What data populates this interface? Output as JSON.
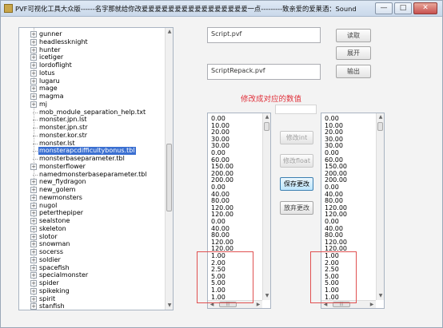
{
  "window": {
    "title": "PVF可视化工具大众版------名字那就给你改爰爰爰爰爰爰爰爰爰爰爰爰爰爰爰爰一点---------致亲爱的爱莱酒：Sound",
    "minimize_label": "—",
    "maximize_label": "□",
    "close_label": "✕"
  },
  "tree": {
    "items": [
      {
        "label": "gunner",
        "expandable": true
      },
      {
        "label": "headlessknight",
        "expandable": true
      },
      {
        "label": "hunter",
        "expandable": true
      },
      {
        "label": "icetiger",
        "expandable": true
      },
      {
        "label": "lordoflight",
        "expandable": true
      },
      {
        "label": "lotus",
        "expandable": true
      },
      {
        "label": "lugaru",
        "expandable": true
      },
      {
        "label": "mage",
        "expandable": true
      },
      {
        "label": "magma",
        "expandable": true
      },
      {
        "label": "mj",
        "expandable": true
      },
      {
        "label": "mob_module_separation_help.txt",
        "expandable": false
      },
      {
        "label": "monster.jpn.lst",
        "expandable": false
      },
      {
        "label": "monster.jpn.str",
        "expandable": false
      },
      {
        "label": "monster.kor.str",
        "expandable": false
      },
      {
        "label": "monster.lst",
        "expandable": false
      },
      {
        "label": "monsterapcdifficultybonus.tbl",
        "expandable": false,
        "selected": true
      },
      {
        "label": "monsterbaseparameter.tbl",
        "expandable": false
      },
      {
        "label": "monsterflower",
        "expandable": true
      },
      {
        "label": "namedmonsterbaseparameter.tbl",
        "expandable": false
      },
      {
        "label": "new_flydragon",
        "expandable": true
      },
      {
        "label": "new_golem",
        "expandable": true
      },
      {
        "label": "newmonsters",
        "expandable": true
      },
      {
        "label": "nugol",
        "expandable": true
      },
      {
        "label": "peterthepiper",
        "expandable": true
      },
      {
        "label": "sealstone",
        "expandable": true
      },
      {
        "label": "skeleton",
        "expandable": true
      },
      {
        "label": "slotor",
        "expandable": true
      },
      {
        "label": "snowman",
        "expandable": true
      },
      {
        "label": "socerss",
        "expandable": true
      },
      {
        "label": "soldier",
        "expandable": true
      },
      {
        "label": "spacefish",
        "expandable": true
      },
      {
        "label": "specialmonster",
        "expandable": true
      },
      {
        "label": "spider",
        "expandable": true
      },
      {
        "label": "spikeking",
        "expandable": true
      },
      {
        "label": "spirit",
        "expandable": true
      },
      {
        "label": "stanfish",
        "expandable": true
      }
    ],
    "scroll_position": 0.45
  },
  "fields": {
    "script_path": "Script.pvf",
    "repack_path": "ScriptRepack.pvf",
    "empty_field": ""
  },
  "buttons": {
    "read": "读取",
    "unpack": "展开",
    "export": "输出",
    "modify_int": "修改int",
    "modify_float": "修改float",
    "save_changes": "保存更改",
    "discard_changes": "放弃更改"
  },
  "section_title": "修改成对应的数值",
  "left_values": [
    "0.00",
    "10.00",
    "20.00",
    "30.00",
    "30.00",
    "0.00",
    "60.00",
    "150.00",
    "200.00",
    "200.00",
    "0.00",
    "40.00",
    "80.00",
    "120.00",
    "120.00",
    "0.00",
    "40.00",
    "80.00",
    "120.00",
    "120.00",
    "1.00",
    "2.00",
    "2.50",
    "5.00",
    "5.00",
    "1.00",
    "1.00"
  ],
  "right_values": [
    "0.00",
    "10.00",
    "20.00",
    "30.00",
    "30.00",
    "0.00",
    "60.00",
    "150.00",
    "200.00",
    "200.00",
    "0.00",
    "40.00",
    "80.00",
    "120.00",
    "120.00",
    "0.00",
    "40.00",
    "80.00",
    "120.00",
    "120.00",
    "1.00",
    "2.00",
    "2.50",
    "5.00",
    "5.00",
    "1.00",
    "1.00"
  ],
  "highlight_start_index": 20
}
